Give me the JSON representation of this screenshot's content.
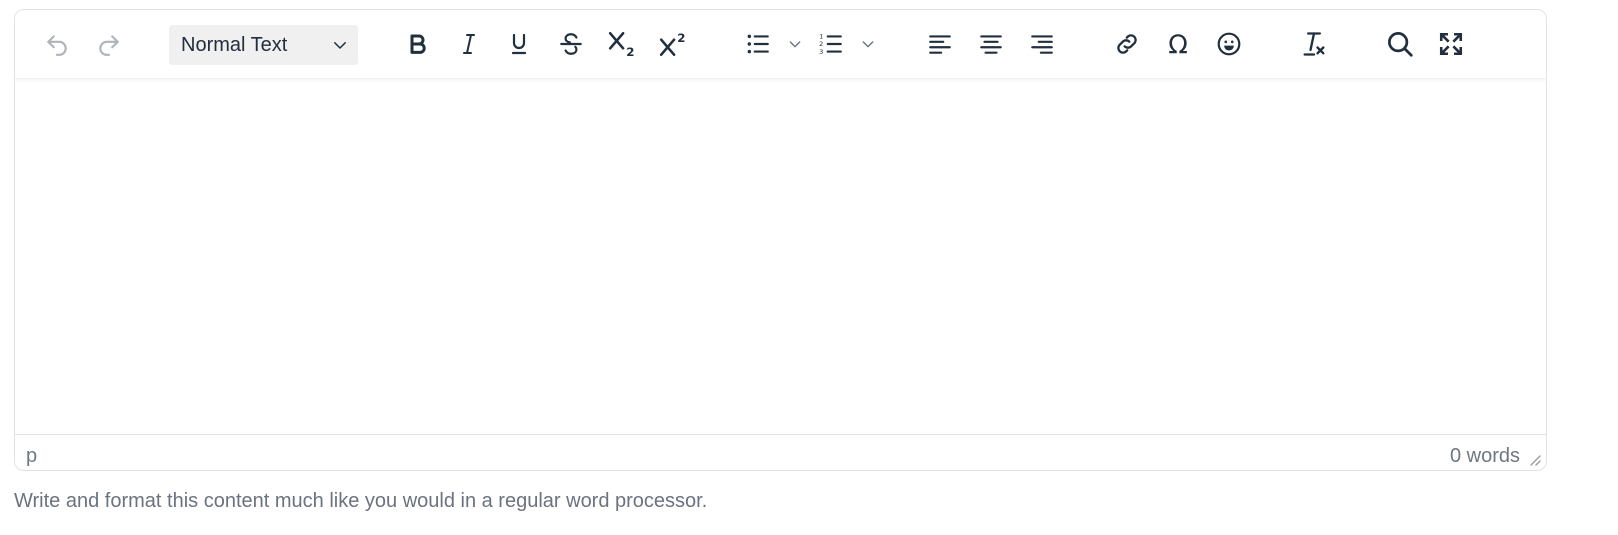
{
  "toolbar": {
    "block_format": "Normal Text",
    "buttons": [
      {
        "icon": "undo-icon"
      },
      {
        "icon": "redo-icon"
      },
      {
        "icon": "bold-icon"
      },
      {
        "icon": "italic-icon"
      },
      {
        "icon": "underline-icon"
      },
      {
        "icon": "strikethrough-icon"
      },
      {
        "icon": "subscript-icon"
      },
      {
        "icon": "superscript-icon"
      },
      {
        "icon": "bullet-list-icon"
      },
      {
        "icon": "numbered-list-icon"
      },
      {
        "icon": "align-left-icon"
      },
      {
        "icon": "align-center-icon"
      },
      {
        "icon": "align-right-icon"
      },
      {
        "icon": "link-icon"
      },
      {
        "icon": "special-character-icon"
      },
      {
        "icon": "emoji-icon"
      },
      {
        "icon": "clear-formatting-icon"
      },
      {
        "icon": "search-icon"
      },
      {
        "icon": "fullscreen-icon"
      }
    ]
  },
  "statusbar": {
    "element_path": "p",
    "word_count": "0 words"
  },
  "help_text": "Write and format this content much like you would in a regular word processor.",
  "colors": {
    "icon": "#222f3e",
    "icon_disabled": "#6f7782",
    "border": "#e3e3e3",
    "select_bg": "#f0f0f0",
    "muted_text": "#6b7280"
  }
}
